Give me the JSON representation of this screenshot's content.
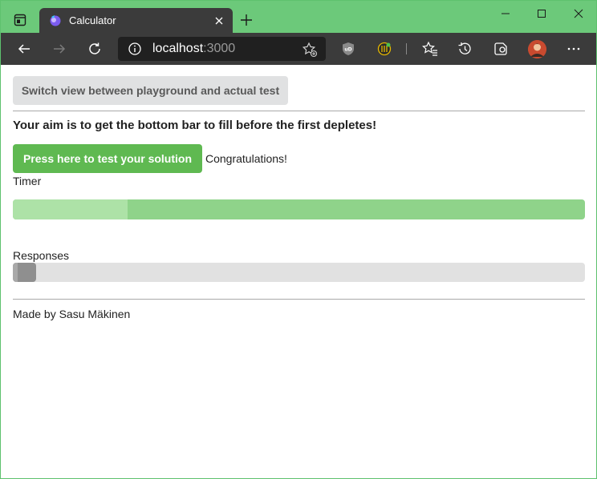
{
  "browser": {
    "tab_title": "Calculator",
    "address_host": "localhost",
    "address_port": ":3000",
    "icons": [
      "window-menu-icon",
      "favicon",
      "tab-close-icon",
      "new-tab-icon",
      "minimize-icon",
      "maximize-icon",
      "close-window-icon",
      "back-icon",
      "forward-icon",
      "refresh-icon",
      "info-icon",
      "add-favorite-icon",
      "ublock-icon",
      "extension-icon",
      "favorites-icon",
      "history-icon",
      "collections-icon",
      "profile-avatar",
      "more-icon"
    ],
    "colors": {
      "titlebar": "#6cc97a",
      "toolbar": "#3b3b3b",
      "address_bg": "#202020"
    }
  },
  "page": {
    "switch_button_label": "Switch view between playground and actual test",
    "aim_text": "Your aim is to get the bottom bar to fill before the first depletes!",
    "test_button_label": "Press here to test your solution",
    "status_text": "Congratulations!",
    "timer_label": "Timer",
    "timer_progress": 0.2,
    "responses_label": "Responses",
    "responses_progress": 0.04,
    "footer_text": "Made by Sasu Mäkinen",
    "colors": {
      "test_button": "#5fb951",
      "timer_track": "#8fd38a",
      "timer_fill": "#ade2a7",
      "responses_fill": "#8f8f8f"
    }
  }
}
